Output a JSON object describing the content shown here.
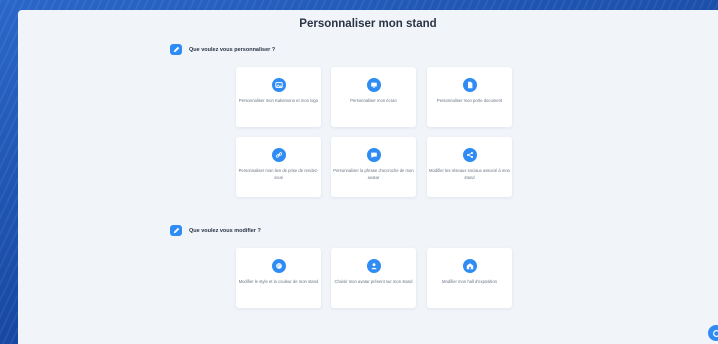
{
  "page": {
    "title": "Personnaliser mon stand"
  },
  "sections": [
    {
      "heading": "Que voulez vous personnaliser ?",
      "cards": [
        {
          "label": "Personnaliser mon Kakemono et mon logo",
          "icon": "image-icon"
        },
        {
          "label": "Personnaliser mon écran",
          "icon": "screen-icon"
        },
        {
          "label": "Personnaliser mon porte document",
          "icon": "document-icon"
        },
        {
          "label": "Personnaliser mon lien de prise de rendez-vous",
          "icon": "link-icon"
        },
        {
          "label": "Personnaliser la phrase d'accroche de mon avatar",
          "icon": "chat-bubble-icon"
        },
        {
          "label": "Modifier les réseaux sociaux associé à mon stand",
          "icon": "share-icon"
        }
      ]
    },
    {
      "heading": "Que voulez vous modifier ?",
      "cards": [
        {
          "label": "Modifier le style et la couleur de mon stand",
          "icon": "palette-icon"
        },
        {
          "label": "Choisir mon avatar présent sur mon stand",
          "icon": "user-icon"
        },
        {
          "label": "Modifier mon hall d'exposition",
          "icon": "hall-icon"
        }
      ]
    }
  ],
  "colors": {
    "accent": "#2f8cf5",
    "panel": "#f1f4f9",
    "background": "#1a4fa8"
  }
}
